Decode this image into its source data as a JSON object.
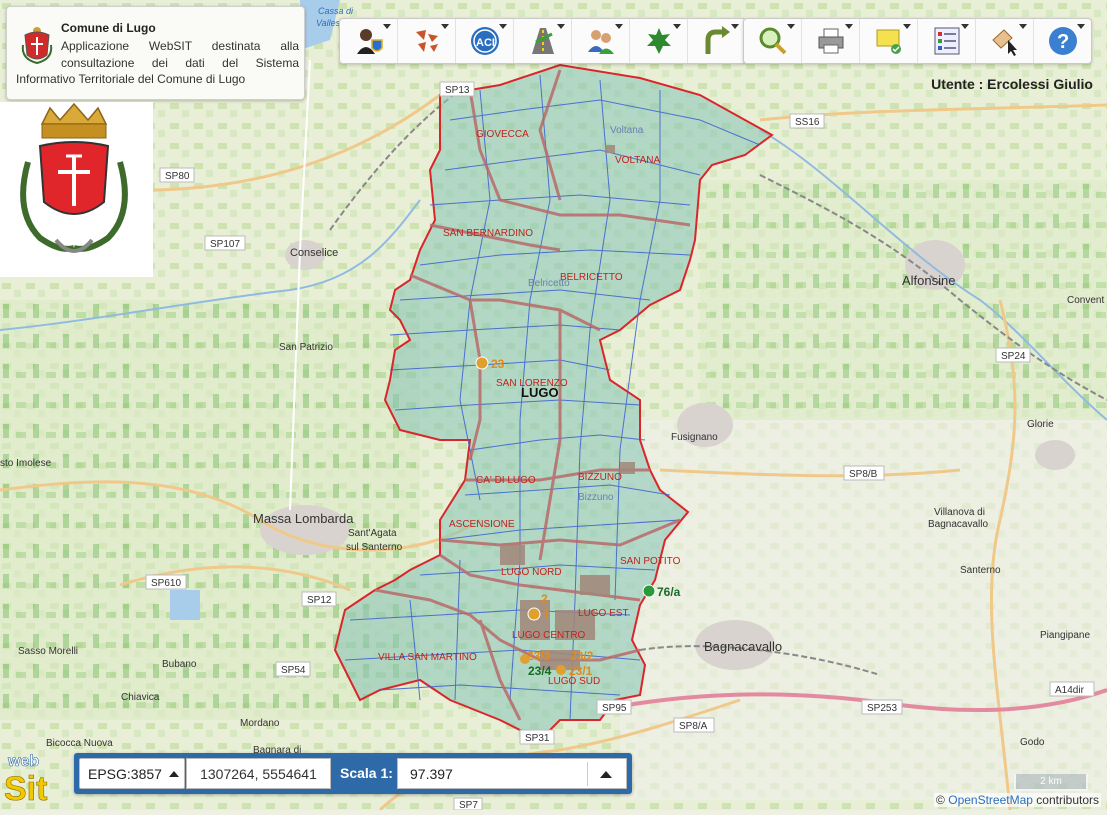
{
  "header": {
    "title": "Comune di Lugo",
    "description_line": "Applicazione WebSIT destinata alla consultazione dei dati del Sistema",
    "description_line2": "Informativo Territoriale del Comune di Lugo"
  },
  "user": {
    "label": "Utente : Ercolessi Giulio"
  },
  "toolbar": {
    "group1": [
      {
        "icon": "user-shield-icon"
      },
      {
        "icon": "polygon-arrows-icon"
      },
      {
        "icon": "aci-logo-icon"
      },
      {
        "icon": "road-icon"
      },
      {
        "icon": "people-icon"
      },
      {
        "icon": "leaf-icon"
      },
      {
        "icon": "route-arrow-icon"
      }
    ],
    "group2": [
      {
        "icon": "zoom-magnifier-icon"
      },
      {
        "icon": "printer-icon"
      },
      {
        "icon": "note-check-icon"
      },
      {
        "icon": "checklist-icon"
      },
      {
        "icon": "pencil-pointer-icon"
      },
      {
        "icon": "help-icon"
      }
    ]
  },
  "map": {
    "zones": [
      "GIOVECCA",
      "VOLTANA",
      "SAN BERNARDINO",
      "BELRICETTO",
      "SAN LORENZO",
      "CA' DI LUGO",
      "BIZZUNO",
      "ASCENSIONE",
      "LUGO NORD",
      "SAN POTITO",
      "LUGO EST",
      "LUGO CENTRO",
      "VILLA SAN MARTINO",
      "LUGO SUD"
    ],
    "main_label": "LUGO",
    "markers": [
      "23",
      "2",
      "1",
      "23/3",
      "23/2",
      "23/4",
      "23/1",
      "76/a"
    ],
    "places": [
      "Alfonsine",
      "Conselice",
      "San Patrizio",
      "Fusignano",
      "Glorie",
      "Massa Lombarda",
      "Sant'Agata",
      "sul Santerno",
      "Bagnacavallo",
      "Villanova di",
      "Bagnacavallo",
      "Santerno",
      "Piangipane",
      "Sasso Morelli",
      "Bubano",
      "Chiavica",
      "Mordano",
      "Bicocca Nuova",
      "Bagnara di",
      "sto Imolese",
      "Convent",
      "Godo",
      "Belricetto",
      "Voltana",
      "Bizzuno",
      "Cassa di",
      "Valles"
    ],
    "roads": [
      "SP13",
      "SS16",
      "SP80",
      "SP107",
      "SP24",
      "SP8/B",
      "SP610",
      "SP12",
      "SP54",
      "SP95",
      "SP31",
      "SP8/A",
      "SP253",
      "A14dir",
      "SP7"
    ]
  },
  "bottom": {
    "epsg": "EPSG:3857",
    "coords": "1307264, 5554641",
    "scala_label": "Scala 1:",
    "scala_value": "97.397"
  },
  "scalebar_label": "2 km",
  "attribution": {
    "symbol": "©",
    "link": "OpenStreetMap",
    "suffix": "contributors"
  },
  "logo_text": {
    "top": "web",
    "bottom": "Sit"
  },
  "colors": {
    "boundary": "#d9262b",
    "sections": "#3a5fd0",
    "zone_lines": "#b86a6a",
    "fill": "#8ec7b8",
    "toolbar_bar": "#2f6aa8"
  }
}
